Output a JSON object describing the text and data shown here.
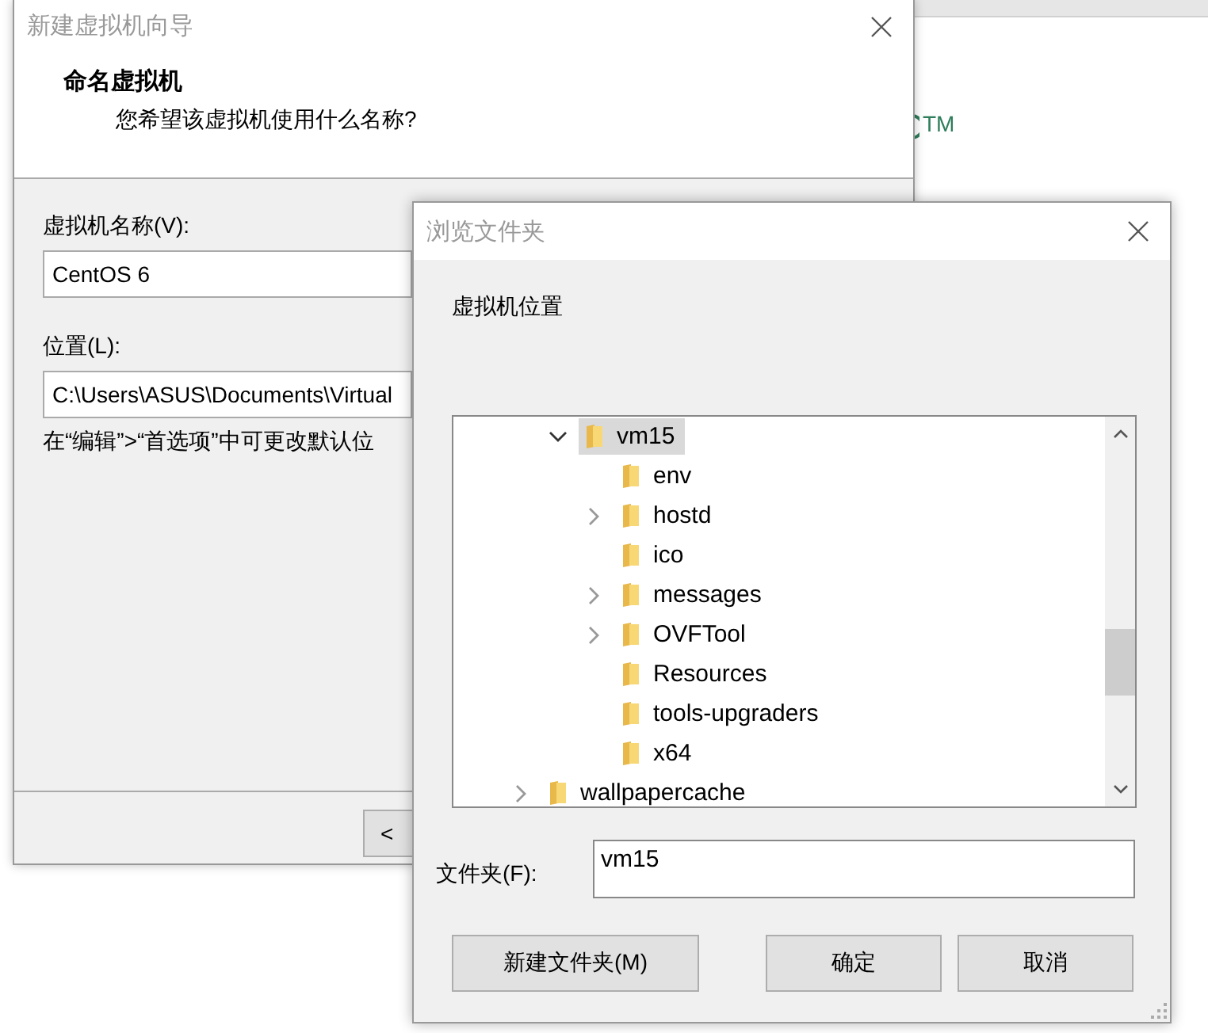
{
  "background_app": {
    "trademark": "TM"
  },
  "wizard": {
    "title": "新建虚拟机向导",
    "heading": "命名虚拟机",
    "subheading": "您希望该虚拟机使用什么名称?",
    "name_label": "虚拟机名称(V):",
    "name_value": "CentOS 6",
    "location_label": "位置(L):",
    "location_value": "C:\\Users\\ASUS\\Documents\\Virtual",
    "hint": "在“编辑”>“首选项”中可更改默认位",
    "back_button": "<"
  },
  "browse": {
    "title": "浏览文件夹",
    "prompt": "虚拟机位置",
    "tree": {
      "continued_children": [
        {
          "label": "vm15",
          "kind": "branch",
          "expanded": true,
          "selected": true,
          "children": [
            {
              "label": "env",
              "kind": "leaf",
              "selected": false
            },
            {
              "label": "hostd",
              "kind": "branch",
              "expanded": false,
              "selected": false
            },
            {
              "label": "ico",
              "kind": "leaf",
              "selected": false
            },
            {
              "label": "messages",
              "kind": "branch",
              "expanded": false,
              "selected": false
            },
            {
              "label": "OVFTool",
              "kind": "branch",
              "expanded": false,
              "selected": false
            },
            {
              "label": "Resources",
              "kind": "leaf",
              "selected": false
            },
            {
              "label": "tools-upgraders",
              "kind": "leaf",
              "selected": false
            },
            {
              "label": "x64",
              "kind": "leaf",
              "selected": false
            }
          ]
        }
      ],
      "items": [
        {
          "label": "wallpapercache",
          "kind": "branch",
          "expanded": false,
          "selected": false
        }
      ]
    },
    "folder_label": "文件夹(F):",
    "folder_value": "vm15",
    "buttons": [
      "新建文件夹(M)",
      "确定",
      "取消"
    ]
  }
}
